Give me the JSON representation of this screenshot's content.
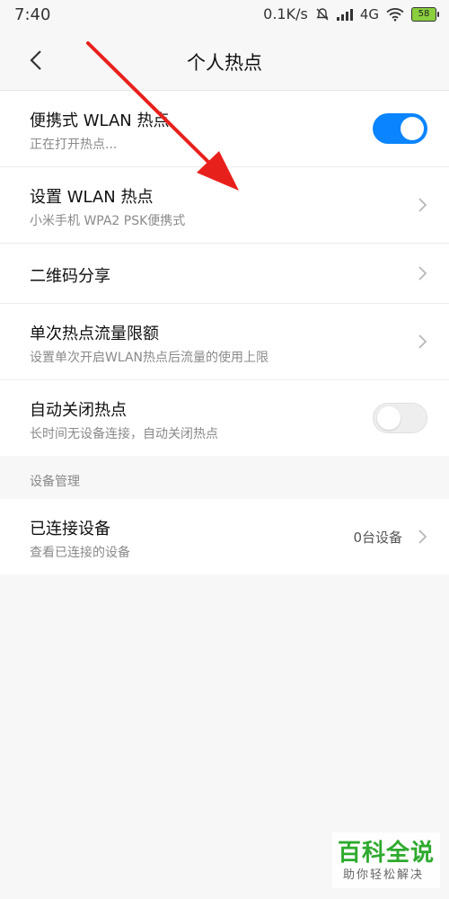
{
  "status_bar": {
    "time": "7:40",
    "net_speed": "0.1K/s",
    "net_type": "4G",
    "battery": "58",
    "icons": [
      "mute-bell-icon",
      "signal-icon",
      "wifi-icon",
      "battery-icon"
    ]
  },
  "header": {
    "title": "个人热点",
    "back_icon": "back-chevron-icon"
  },
  "settings": {
    "items": [
      {
        "title": "便携式 WLAN 热点",
        "subtitle": "正在打开热点...",
        "control": "toggle",
        "toggle_on": true
      },
      {
        "title": "设置 WLAN 热点",
        "subtitle": "小米手机 WPA2 PSK便携式",
        "control": "chevron"
      },
      {
        "title": "二维码分享",
        "control": "chevron"
      },
      {
        "title": "单次热点流量限额",
        "subtitle": "设置单次开启WLAN热点后流量的使用上限",
        "control": "chevron"
      },
      {
        "title": "自动关闭热点",
        "subtitle": "长时间无设备连接，自动关闭热点",
        "control": "toggle",
        "toggle_on": false
      }
    ]
  },
  "device_section": {
    "header": "设备管理",
    "items": [
      {
        "title": "已连接设备",
        "subtitle": "查看已连接的设备",
        "value": "0台设备",
        "control": "chevron"
      }
    ]
  },
  "watermark": {
    "title": "百科全说",
    "subtitle": "助你轻松解决"
  },
  "colors": {
    "accent": "#0a84ff",
    "annotation_arrow": "#e8201c",
    "watermark_green": "#2eaa2e"
  }
}
